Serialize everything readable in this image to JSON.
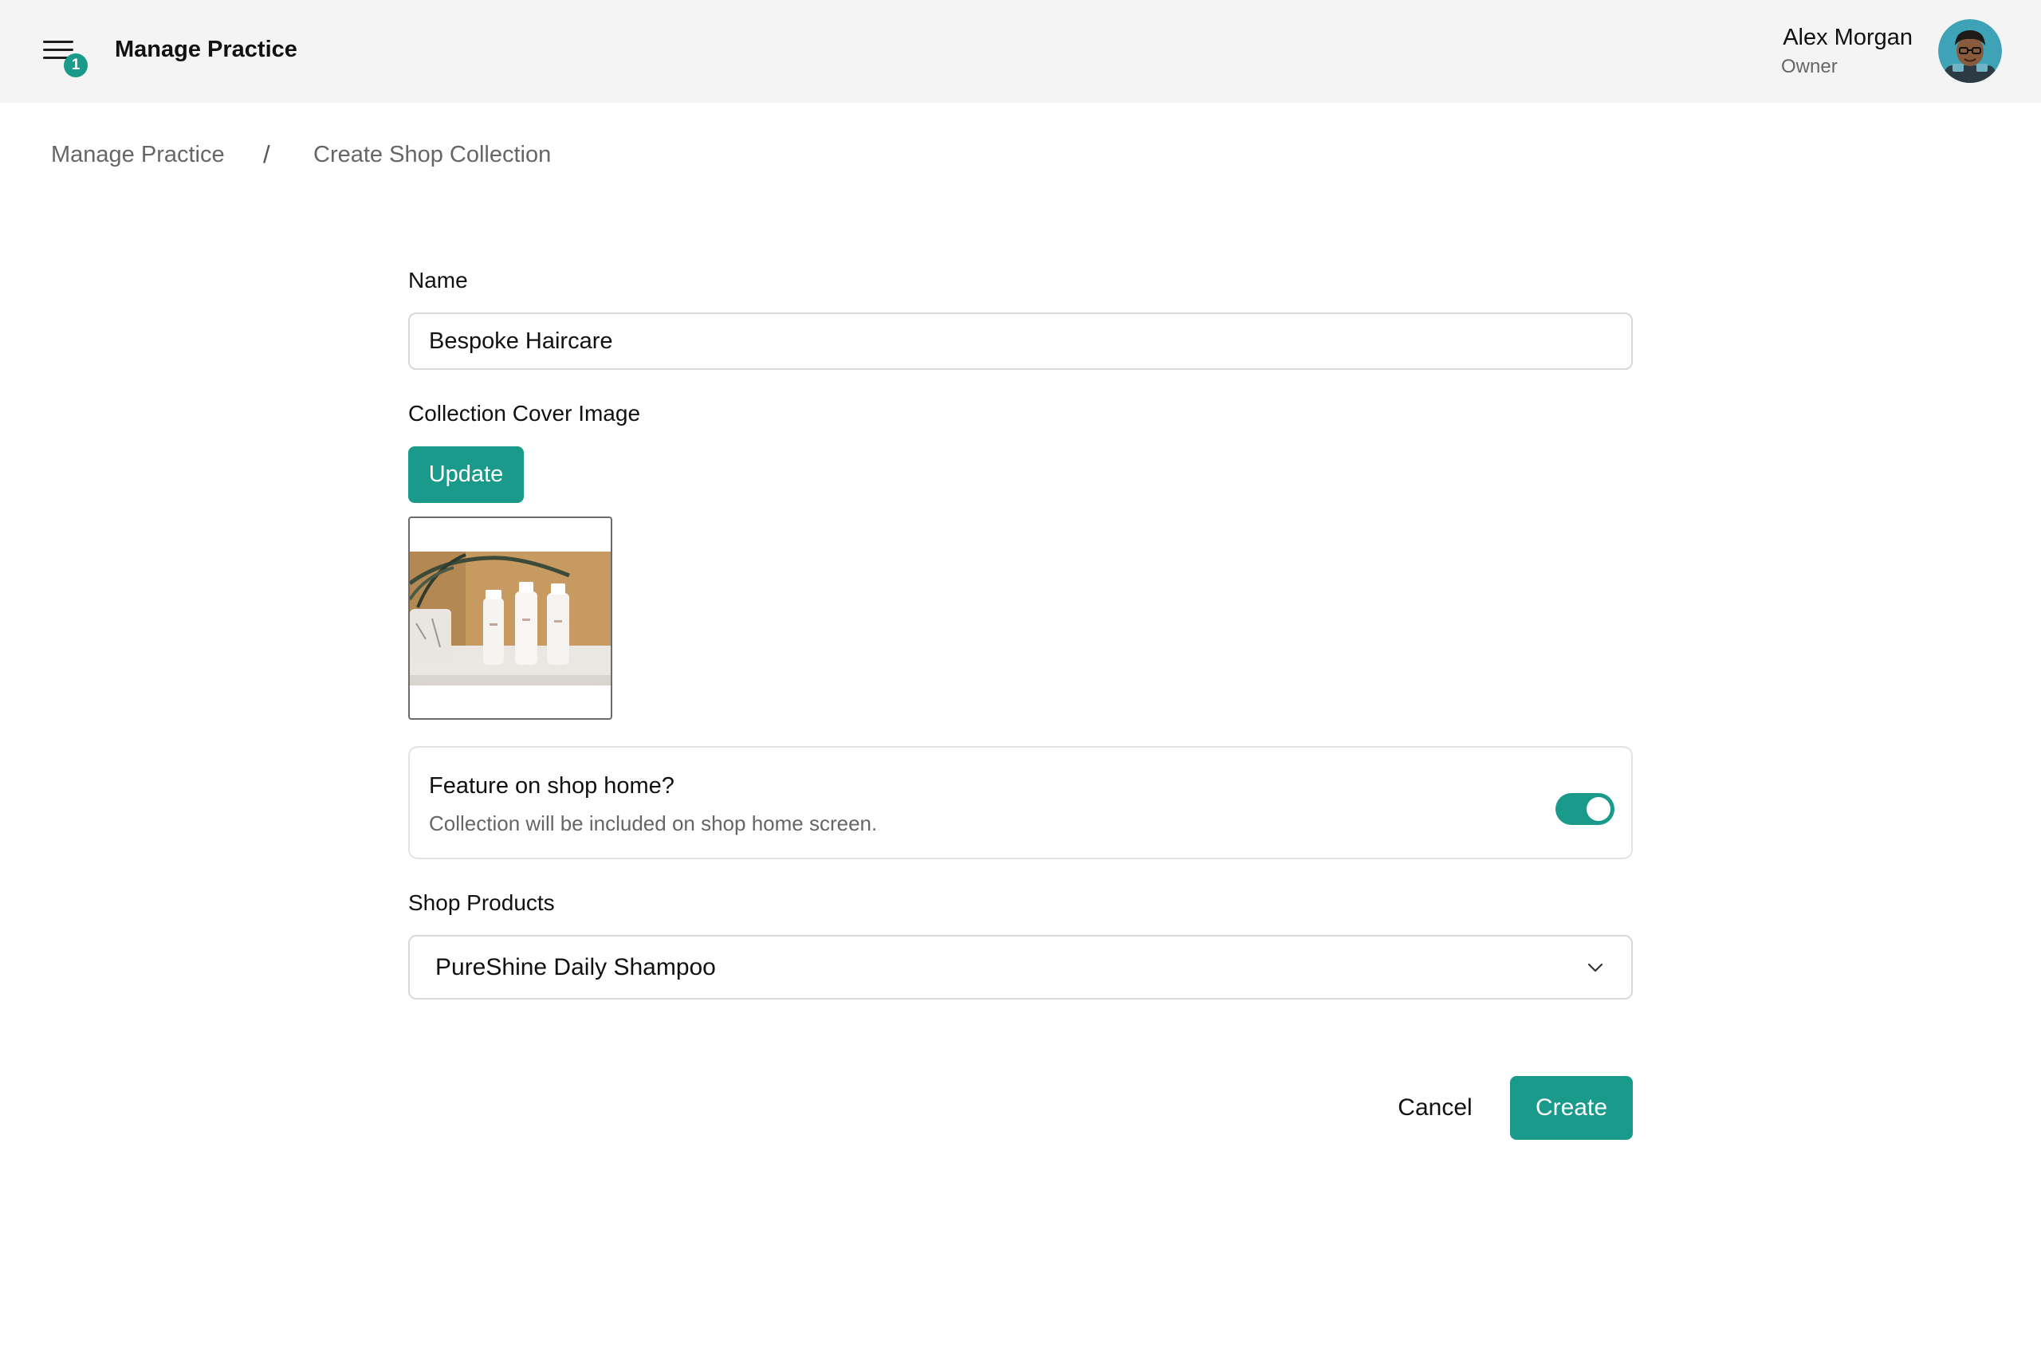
{
  "header": {
    "title": "Manage Practice",
    "menu_badge": "1",
    "menu_icon": "hamburger-menu-icon",
    "user": {
      "name": "Alex Morgan",
      "role": "Owner"
    }
  },
  "breadcrumb": {
    "items": [
      "Manage Practice",
      "Create Shop Collection"
    ],
    "separator": "/"
  },
  "form": {
    "name_label": "Name",
    "name_value": "Bespoke Haircare",
    "cover_label": "Collection Cover Image",
    "update_button": "Update",
    "feature": {
      "title": "Feature on shop home?",
      "description": "Collection will be included on shop home screen.",
      "enabled": true
    },
    "products_label": "Shop Products",
    "products_selected": "PureShine Daily Shampoo",
    "cancel_button": "Cancel",
    "create_button": "Create"
  },
  "colors": {
    "accent": "#1a9a8b",
    "topbar_bg": "#f4f4f4",
    "muted_text": "#666666"
  }
}
